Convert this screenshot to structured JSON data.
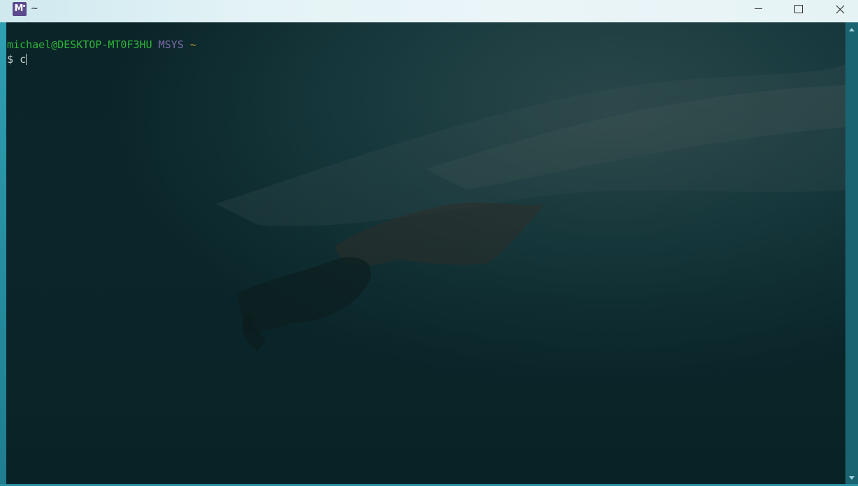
{
  "window": {
    "title": "~",
    "icon": "msys2-icon",
    "controls": {
      "minimize": "minimize-icon",
      "maximize": "maximize-icon",
      "close": "close-icon"
    }
  },
  "terminal": {
    "prompt_user_host": "michael@DESKTOP-MT0F3HU",
    "prompt_system": "MSYS",
    "prompt_cwd": "~",
    "prompt_symbol": "$",
    "input_value": "c"
  },
  "colors": {
    "user_host": "#2fb63a",
    "system": "#7c6aa8",
    "cwd": "#c2a33b",
    "background": "#0a2428"
  }
}
